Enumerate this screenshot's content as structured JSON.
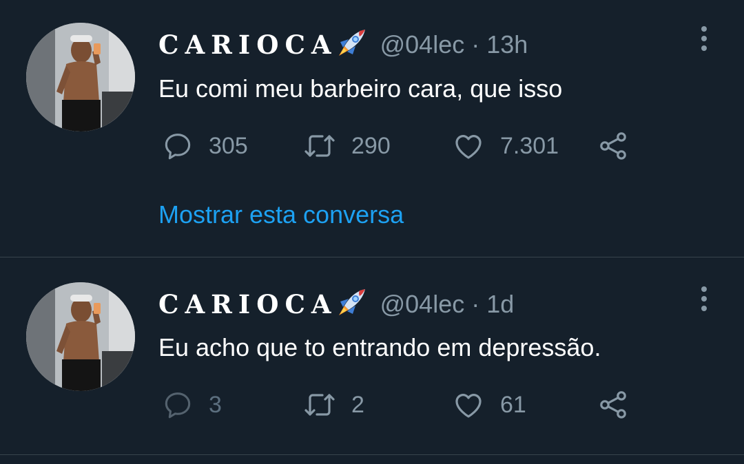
{
  "tweets": [
    {
      "display_name": "CARIOCA",
      "handle": "@04lec",
      "separator": "·",
      "time": "13h",
      "text": "Eu comi meu barbeiro cara, que isso",
      "replies": "305",
      "retweets": "290",
      "likes": "7.301",
      "show_thread": "Mostrar esta conversa"
    },
    {
      "display_name": "CARIOCA",
      "handle": "@04lec",
      "separator": "·",
      "time": "1d",
      "text": "Eu acho que to entrando em depressão.",
      "replies": "3",
      "retweets": "2",
      "likes": "61"
    }
  ],
  "icons": {
    "name_emoji": "rocket-icon",
    "reply": "reply-icon",
    "retweet": "retweet-icon",
    "like": "heart-icon",
    "share": "share-icon",
    "more": "more-options-icon"
  },
  "colors": {
    "background": "#15202b",
    "text_primary": "#ffffff",
    "text_secondary": "#8899a6",
    "link": "#1da1f2",
    "divider": "#38444d"
  }
}
